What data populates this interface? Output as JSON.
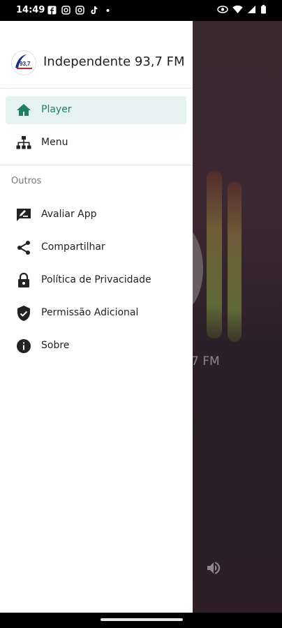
{
  "status_bar": {
    "time": "14:49",
    "left_icons": [
      "facebook-icon",
      "instagram-icon",
      "instagram-icon",
      "tiktok-icon",
      "dot-icon"
    ],
    "right_icons": [
      "eye-icon",
      "wifi-icon",
      "signal-icon",
      "battery-icon"
    ]
  },
  "drawer": {
    "app_title": "Independente 93,7 FM",
    "logo_text": "93,7",
    "items": [
      {
        "label": "Player",
        "icon": "home-icon",
        "active": true
      },
      {
        "label": "Menu",
        "icon": "sitemap-icon",
        "active": false
      }
    ],
    "section_title": "Outros",
    "others": [
      {
        "label": "Avaliar App",
        "icon": "rate-review-icon"
      },
      {
        "label": "Compartilhar",
        "icon": "share-icon"
      },
      {
        "label": "Política de Privacidade",
        "icon": "lock-icon"
      },
      {
        "label": "Permissão Adicional",
        "icon": "shield-check-icon"
      },
      {
        "label": "Sobre",
        "icon": "info-icon"
      }
    ]
  },
  "background": {
    "title_fragment": "7 FM"
  },
  "colors": {
    "accent": "#1e7f66",
    "active_bg": "#e6f2ef"
  }
}
